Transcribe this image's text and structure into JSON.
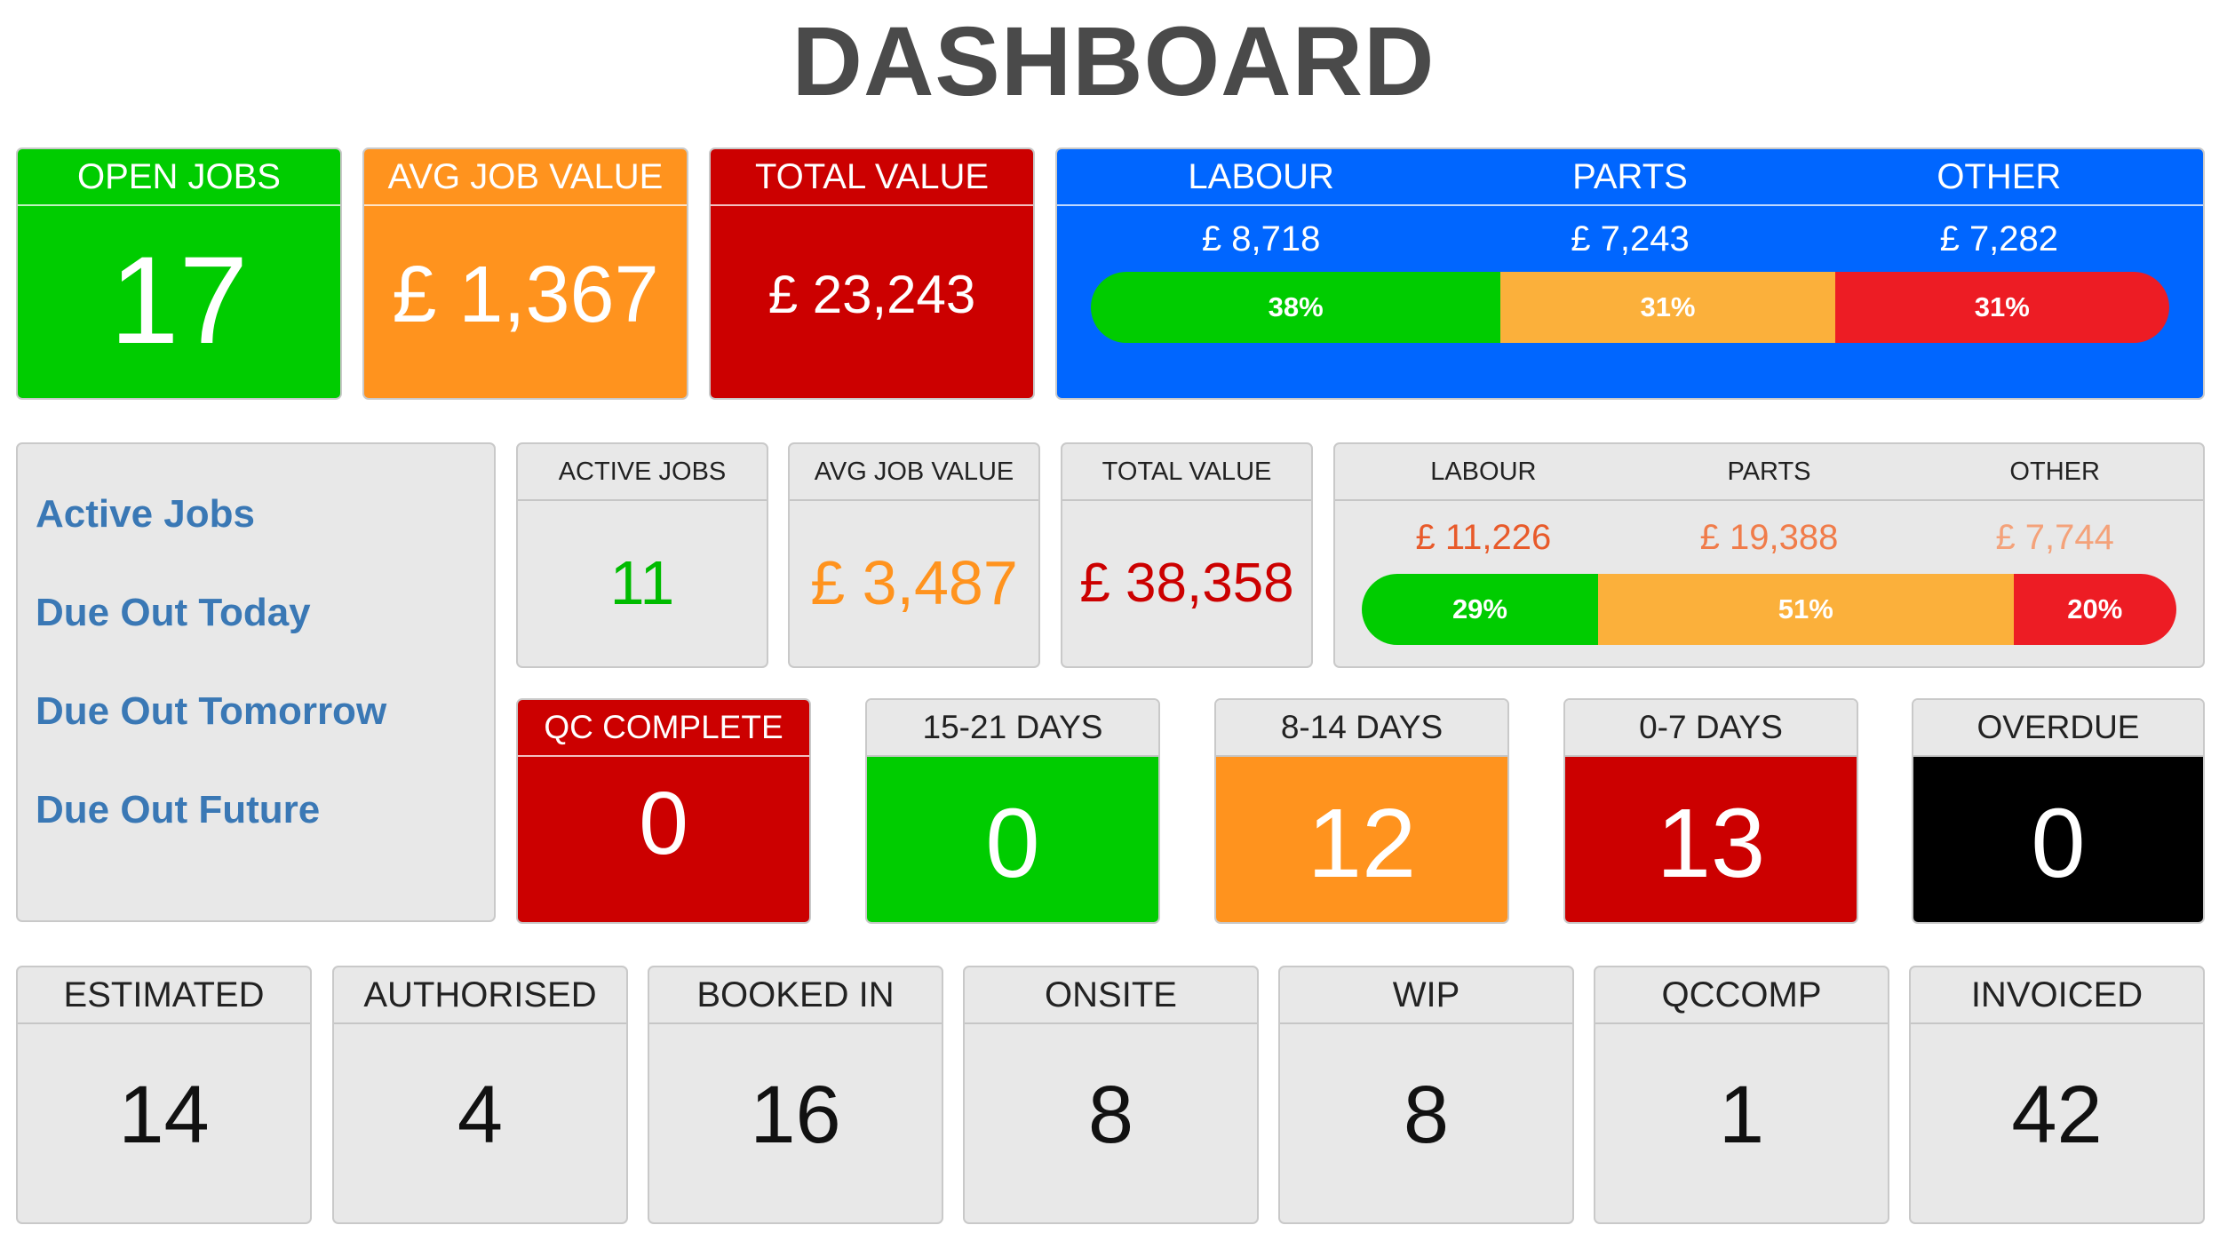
{
  "title": "DASHBOARD",
  "top": {
    "open_jobs": {
      "label": "OPEN JOBS",
      "value": "17"
    },
    "avg_job_value": {
      "label": "AVG JOB VALUE",
      "value": "£ 1,367"
    },
    "total_value": {
      "label": "TOTAL VALUE",
      "value": "£ 23,243"
    },
    "breakdown": {
      "labour": {
        "label": "LABOUR",
        "value": "£ 8,718",
        "pct": "38%"
      },
      "parts": {
        "label": "PARTS",
        "value": "£ 7,243",
        "pct": "31%"
      },
      "other": {
        "label": "OTHER",
        "value": "£ 7,282",
        "pct": "31%"
      }
    }
  },
  "sidebar": {
    "items": [
      {
        "label": "Active Jobs"
      },
      {
        "label": "Due Out Today"
      },
      {
        "label": "Due Out Tomorrow"
      },
      {
        "label": "Due Out Future"
      }
    ]
  },
  "active": {
    "active_jobs": {
      "label": "ACTIVE JOBS",
      "value": "11"
    },
    "avg_job_value": {
      "label": "AVG JOB VALUE",
      "value": "£ 3,487"
    },
    "total_value": {
      "label": "TOTAL VALUE",
      "value": "£ 38,358"
    },
    "breakdown": {
      "labour": {
        "label": "LABOUR",
        "value": "£ 11,226",
        "pct": "29%"
      },
      "parts": {
        "label": "PARTS",
        "value": "£ 19,388",
        "pct": "51%"
      },
      "other": {
        "label": "OTHER",
        "value": "£ 7,744",
        "pct": "20%"
      }
    }
  },
  "status": {
    "qc_complete": {
      "label": "QC COMPLETE",
      "value": "0"
    },
    "days_15_21": {
      "label": "15-21 DAYS",
      "value": "0"
    },
    "days_8_14": {
      "label": "8-14 DAYS",
      "value": "12"
    },
    "days_0_7": {
      "label": "0-7 DAYS",
      "value": "13"
    },
    "overdue": {
      "label": "OVERDUE",
      "value": "0"
    }
  },
  "stages": [
    {
      "label": "ESTIMATED",
      "value": "14"
    },
    {
      "label": "AUTHORISED",
      "value": "4"
    },
    {
      "label": "BOOKED IN",
      "value": "16"
    },
    {
      "label": "ONSITE",
      "value": "8"
    },
    {
      "label": "WIP",
      "value": "8"
    },
    {
      "label": "QCCOMP",
      "value": "1"
    },
    {
      "label": "INVOICED",
      "value": "42"
    }
  ],
  "colors": {
    "green": "#00cc00",
    "orange": "#ff931e",
    "red": "#cc0000",
    "blue": "#0066ff",
    "link": "#3a78b5",
    "labour_text": "#e85a2a",
    "parts_text": "#f07c4a",
    "other_text": "#f4a27a"
  }
}
